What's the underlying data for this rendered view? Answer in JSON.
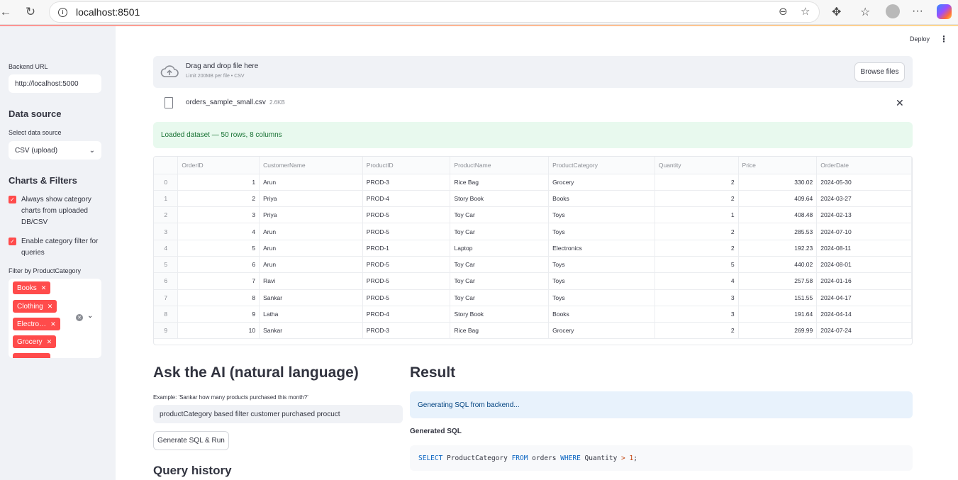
{
  "browser": {
    "url": "localhost:8501",
    "icons": [
      "back-icon",
      "reload-icon",
      "info-icon",
      "zoom-icon",
      "star-icon",
      "extensions-icon",
      "favorites-icon",
      "profile-icon",
      "more-icon",
      "copilot-icon"
    ]
  },
  "sidebar": {
    "backend_label": "Backend URL",
    "backend_value": "http://localhost:5000",
    "data_source_heading": "Data source",
    "data_source_label": "Select data source",
    "data_source_value": "CSV (upload)",
    "charts_heading": "Charts & Filters",
    "checkbox1": "Always show category charts from uploaded DB/CSV",
    "checkbox2": "Enable category filter for queries",
    "filter_label": "Filter by ProductCategory",
    "tags": [
      "Books",
      "Clothing",
      "Electro…",
      "Grocery"
    ]
  },
  "header": {
    "deploy": "Deploy",
    "menu": "⋮"
  },
  "uploader": {
    "title": "Drag and drop file here",
    "subtitle": "Limit 200MB per file • CSV",
    "browse": "Browse files",
    "file_name": "orders_sample_small.csv",
    "file_size": "2.6KB"
  },
  "status": {
    "success": "Loaded dataset — 50 rows, 8 columns"
  },
  "table": {
    "columns": [
      "",
      "OrderID",
      "CustomerName",
      "ProductID",
      "ProductName",
      "ProductCategory",
      "Quantity",
      "Price",
      "OrderDate"
    ],
    "rows": [
      [
        "0",
        "1",
        "Arun",
        "PROD-3",
        "Rice Bag",
        "Grocery",
        "2",
        "330.02",
        "2024-05-30"
      ],
      [
        "1",
        "2",
        "Priya",
        "PROD-4",
        "Story Book",
        "Books",
        "2",
        "409.64",
        "2024-03-27"
      ],
      [
        "2",
        "3",
        "Priya",
        "PROD-5",
        "Toy Car",
        "Toys",
        "1",
        "408.48",
        "2024-02-13"
      ],
      [
        "3",
        "4",
        "Arun",
        "PROD-5",
        "Toy Car",
        "Toys",
        "2",
        "285.53",
        "2024-07-10"
      ],
      [
        "4",
        "5",
        "Arun",
        "PROD-1",
        "Laptop",
        "Electronics",
        "2",
        "192.23",
        "2024-08-11"
      ],
      [
        "5",
        "6",
        "Arun",
        "PROD-5",
        "Toy Car",
        "Toys",
        "5",
        "440.02",
        "2024-08-01"
      ],
      [
        "6",
        "7",
        "Ravi",
        "PROD-5",
        "Toy Car",
        "Toys",
        "4",
        "257.58",
        "2024-01-16"
      ],
      [
        "7",
        "8",
        "Sankar",
        "PROD-5",
        "Toy Car",
        "Toys",
        "3",
        "151.55",
        "2024-04-17"
      ],
      [
        "8",
        "9",
        "Latha",
        "PROD-4",
        "Story Book",
        "Books",
        "3",
        "191.64",
        "2024-04-14"
      ],
      [
        "9",
        "10",
        "Sankar",
        "PROD-3",
        "Rice Bag",
        "Grocery",
        "2",
        "269.99",
        "2024-07-24"
      ]
    ]
  },
  "ask": {
    "heading": "Ask the AI (natural language)",
    "example": "Example: 'Sankar how many products purchased this month?'",
    "input_value": "productCategory based filter customer purchased procuct",
    "button": "Generate SQL & Run",
    "history_heading": "Query history"
  },
  "result": {
    "heading": "Result",
    "info": "Generating SQL from backend...",
    "generated_label": "Generated SQL",
    "sql": {
      "select": "SELECT",
      "col": " ProductCategory ",
      "from": "FROM",
      "table": " orders ",
      "where": "WHERE",
      "field": " Quantity ",
      "op": ">",
      "value": " 1",
      "end": ";"
    }
  }
}
